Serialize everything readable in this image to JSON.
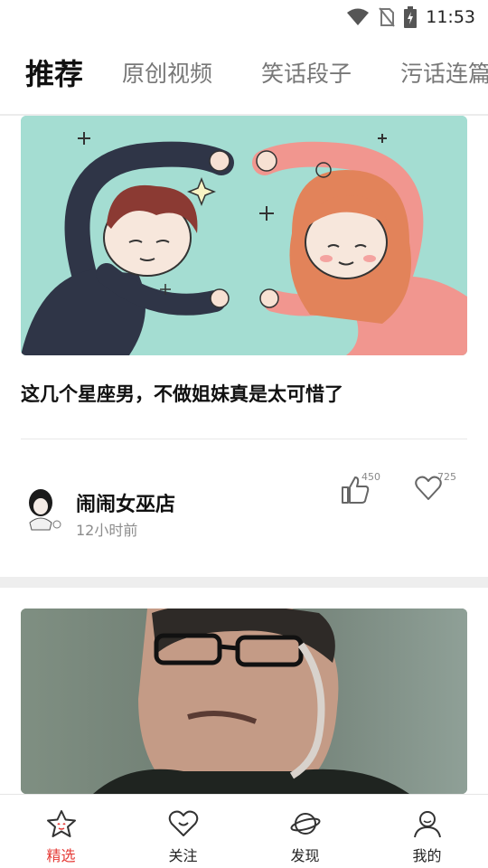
{
  "status_bar": {
    "time": "11:53"
  },
  "tabs": [
    {
      "label": "推荐",
      "active": true
    },
    {
      "label": "原创视频",
      "active": false
    },
    {
      "label": "笑话段子",
      "active": false
    },
    {
      "label": "污话连篇",
      "active": false
    }
  ],
  "feed": {
    "post1": {
      "title": "这几个星座男，不做姐妹真是太可惜了",
      "author": "闹闹女巫店",
      "time_ago": "12小时前",
      "likes": "450",
      "favorites": "725"
    }
  },
  "bottom_nav": [
    {
      "label": "精选",
      "icon": "star-icon",
      "active": true
    },
    {
      "label": "关注",
      "icon": "heart-face-icon",
      "active": false
    },
    {
      "label": "发现",
      "icon": "planet-icon",
      "active": false
    },
    {
      "label": "我的",
      "icon": "user-icon",
      "active": false
    }
  ],
  "colors": {
    "accent": "#e53935",
    "image_bg": "#a4ddd2"
  }
}
